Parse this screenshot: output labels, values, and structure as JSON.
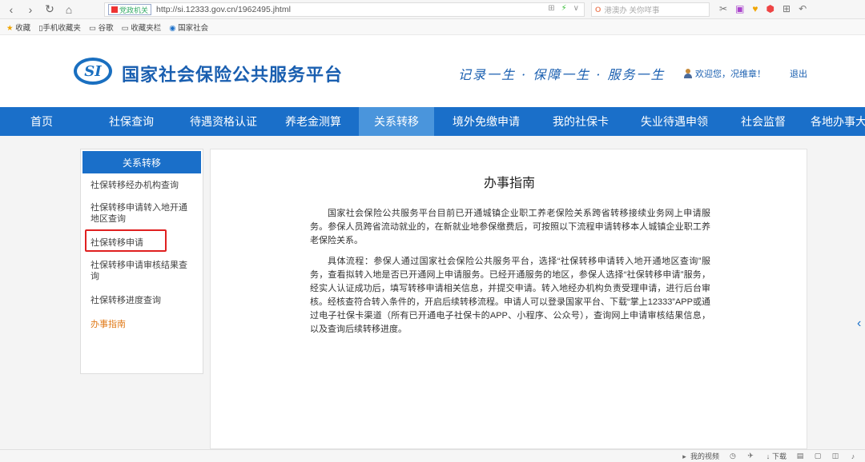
{
  "browser": {
    "back_glyph": "‹",
    "forward_glyph": "›",
    "reload_glyph": "↻",
    "home_glyph": "⌂",
    "site_badge": "党政机关",
    "url": "http://si.12333.gov.cn/1962495.jhtml",
    "search_placeholder": "港澳办 关你咩事",
    "addr_icons": [
      "⊞",
      "⚡",
      "∨"
    ],
    "tool_icons": [
      "✂",
      "▣",
      "♥",
      "⬢",
      "⊞",
      "↶"
    ]
  },
  "bookmarks": {
    "items": [
      "收藏",
      "手机收藏夹",
      "谷歌",
      "收藏夹栏",
      "国家社会"
    ]
  },
  "header": {
    "logo_text": "SI",
    "site_title": "国家社会保险公共服务平台",
    "slogan": "记录一生 · 保障一生 · 服务一生",
    "welcome": "欢迎您，况维章！",
    "logout": "退出"
  },
  "nav": {
    "items": [
      "首页",
      "社保查询",
      "待遇资格认证",
      "养老金测算",
      "关系转移",
      "境外免缴申请",
      "我的社保卡",
      "失业待遇申领",
      "社会监督",
      "各地办事大"
    ],
    "active": "关系转移"
  },
  "sidebar": {
    "heading": "关系转移",
    "items": [
      "社保转移经办机构查询",
      "社保转移申请转入地开通地区查询",
      "社保转移申请",
      "社保转移申请审核结果查询",
      "社保转移进度查询",
      "办事指南"
    ]
  },
  "content": {
    "title": "办事指南",
    "para1": "国家社会保险公共服务平台目前已开通城镇企业职工养老保险关系跨省转移接续业务网上申请服务。参保人员跨省流动就业的，在新就业地参保缴费后，可按照以下流程申请转移本人城镇企业职工养老保险关系。",
    "para2": "具体流程：参保人通过国家社会保险公共服务平台，选择“社保转移申请转入地开通地区查询”服务，查看拟转入地是否已开通网上申请服务。已经开通服务的地区，参保人选择“社保转移申请”服务，经实人认证成功后，填写转移申请相关信息，并提交申请。转入地经办机构负责受理申请，进行后台审核。经核查符合转入条件的，开启后续转移流程。申请人可以登录国家平台、下载“掌上12333”APP或通过电子社保卡渠道（所有已开通电子社保卡的APP、小程序、公众号），查询网上申请审核结果信息，以及查询后续转移进度。"
  },
  "statusbar": {
    "items": [
      "我的视频",
      "下载"
    ]
  },
  "colors": {
    "brand_blue": "#1a6fc9",
    "active_tab": "#4a95dc",
    "highlight_red": "#e02020",
    "current_item": "#e07b1a"
  }
}
